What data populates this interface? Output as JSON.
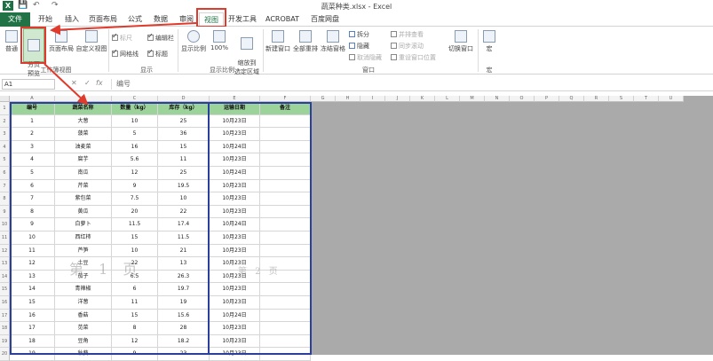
{
  "window": {
    "title": "蔬菜种类.xlsx - Excel"
  },
  "quick_access": {
    "save": "💾",
    "undo": "↶",
    "redo": "↷"
  },
  "tabs": [
    "文件",
    "开始",
    "插入",
    "页面布局",
    "公式",
    "数据",
    "审阅",
    "视图",
    "开发工具",
    "ACROBAT",
    "百度网盘"
  ],
  "active_tab": "视图",
  "ribbon": {
    "workbook_views": {
      "normal": "普通",
      "page_break": "分页\n预览",
      "page_layout": "页面布局",
      "custom_views": "自定义视图",
      "group": "工作簿视图"
    },
    "show": {
      "ruler": "标尺",
      "formula_bar": "编辑栏",
      "gridlines": "网格线",
      "headings": "标题",
      "group": "显示"
    },
    "zoom": {
      "zoom": "显示比例",
      "zoom100": "100%",
      "zoom_to_selection": "缩放到\n选定区域",
      "group": "显示比例"
    },
    "window": {
      "new_window": "新建窗口",
      "arrange_all": "全部重排",
      "freeze_panes": "冻结窗格",
      "split": "拆分",
      "hide": "隐藏",
      "unhide": "取消隐藏",
      "side_by_side": "并排查看",
      "sync_scroll": "同步滚动",
      "reset_position": "重设窗口位置",
      "switch_windows": "切换窗口",
      "group": "窗口"
    },
    "macros": {
      "macros": "宏",
      "group": "宏"
    }
  },
  "formula_bar": {
    "name_box": "A1",
    "fx": "fx",
    "content": "编号"
  },
  "sheet": {
    "columns": [
      "A",
      "B",
      "C",
      "D",
      "E",
      "F",
      "G",
      "H",
      "I",
      "J",
      "K",
      "L",
      "M",
      "N",
      "O",
      "P",
      "Q",
      "R",
      "S",
      "T",
      "U"
    ],
    "headers": [
      "编号",
      "蔬菜名称",
      "数量（kg）",
      "库存（kg）",
      "运输日期",
      "备注"
    ],
    "rows": [
      [
        "1",
        "大葱",
        "10",
        "25",
        "10月23日",
        ""
      ],
      [
        "2",
        "菠菜",
        "5",
        "36",
        "10月23日",
        ""
      ],
      [
        "3",
        "油麦菜",
        "16",
        "15",
        "10月24日",
        ""
      ],
      [
        "4",
        "腐芋",
        "5.6",
        "11",
        "10月23日",
        ""
      ],
      [
        "5",
        "南瓜",
        "12",
        "25",
        "10月24日",
        ""
      ],
      [
        "6",
        "芹菜",
        "9",
        "19.5",
        "10月23日",
        ""
      ],
      [
        "7",
        "紫包菜",
        "7.5",
        "10",
        "10月23日",
        ""
      ],
      [
        "8",
        "黄瓜",
        "20",
        "22",
        "10月23日",
        ""
      ],
      [
        "9",
        "白萝卜",
        "11.5",
        "17.4",
        "10月24日",
        ""
      ],
      [
        "10",
        "西红柿",
        "15",
        "11.5",
        "10月23日",
        ""
      ],
      [
        "11",
        "芦笋",
        "10",
        "21",
        "10月23日",
        ""
      ],
      [
        "12",
        "土豆",
        "22",
        "13",
        "10月23日",
        ""
      ],
      [
        "13",
        "茄子",
        "6.5",
        "26.3",
        "10月23日",
        ""
      ],
      [
        "14",
        "青辣椒",
        "6",
        "19.7",
        "10月23日",
        ""
      ],
      [
        "15",
        "洋葱",
        "11",
        "19",
        "10月23日",
        ""
      ],
      [
        "16",
        "香菇",
        "15",
        "15.6",
        "10月24日",
        ""
      ],
      [
        "17",
        "苋菜",
        "8",
        "28",
        "10月23日",
        ""
      ],
      [
        "18",
        "豆角",
        "12",
        "18.2",
        "10月23日",
        ""
      ],
      [
        "19",
        "秋葵",
        "9",
        "23",
        "10月23日",
        ""
      ]
    ],
    "row_numbers": [
      "1",
      "2",
      "3",
      "4",
      "5",
      "6",
      "7",
      "8",
      "9",
      "10",
      "11",
      "12",
      "13",
      "14",
      "15",
      "16",
      "17",
      "18",
      "19",
      "20"
    ],
    "watermark_page1": "第 1 页",
    "watermark_page2": "第 2 页"
  },
  "colors": {
    "header_fill": "#9bd39b",
    "accent": "#217346",
    "highlight": "#e03a2c",
    "page_border": "#2a3f9e"
  }
}
